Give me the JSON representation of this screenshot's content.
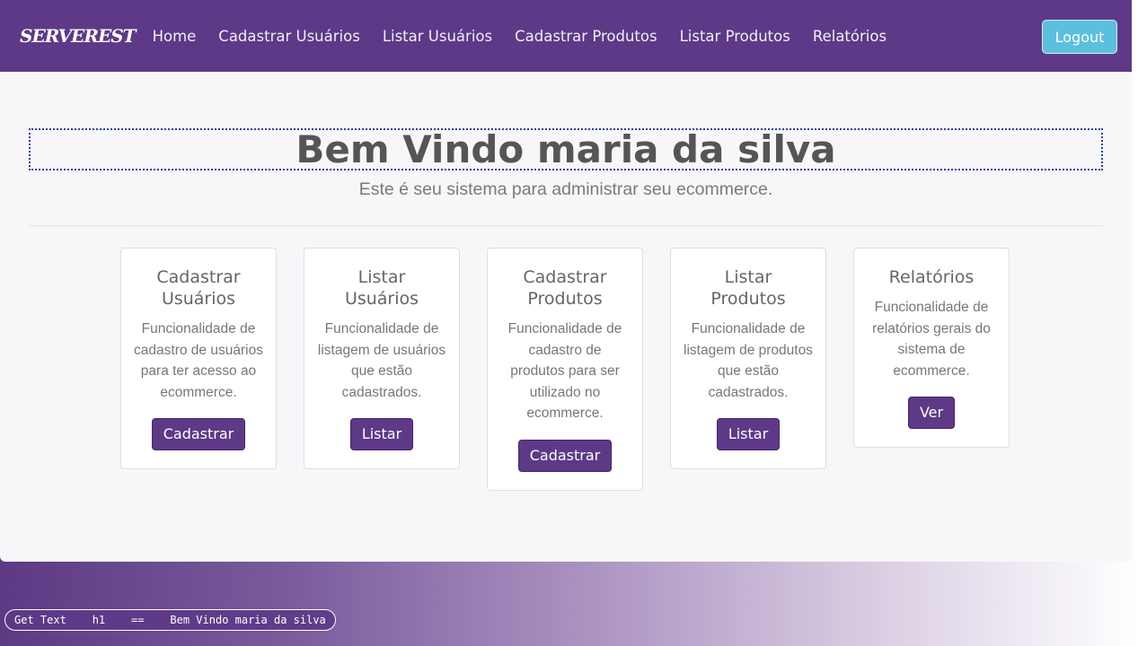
{
  "navbar": {
    "brand": "SERVEREST",
    "links": [
      "Home",
      "Cadastrar Usuários",
      "Listar Usuários",
      "Cadastrar Produtos",
      "Listar Produtos",
      "Relatórios"
    ],
    "logout_label": "Logout"
  },
  "main": {
    "title": "Bem Vindo maria da silva",
    "subtitle": "Este é seu sistema para administrar seu ecommerce.",
    "cards": [
      {
        "title": "Cadastrar Usuários",
        "description": "Funcionalidade de cadastro de usuários para ter acesso ao ecommerce.",
        "button": "Cadastrar"
      },
      {
        "title": "Listar Usuários",
        "description": "Funcionalidade de listagem de usuários que estão cadastrados.",
        "button": "Listar"
      },
      {
        "title": "Cadastrar Produtos",
        "description": "Funcionalidade de cadastro de produtos para ser utilizado no ecommerce.",
        "button": "Cadastrar"
      },
      {
        "title": "Listar Produtos",
        "description": "Funcionalidade de listagem de produtos que estão cadastrados.",
        "button": "Listar"
      },
      {
        "title": "Relatórios",
        "description": "Funcionalidade de relatórios gerais do sistema de ecommerce.",
        "button": "Ver"
      }
    ]
  },
  "status": {
    "text": "Get Text    h1    ==    Bem Vindo maria da silva"
  },
  "colors": {
    "brand": "#5d3987",
    "logout": "#5bc0de",
    "highlight_border": "#2b3f9e"
  }
}
